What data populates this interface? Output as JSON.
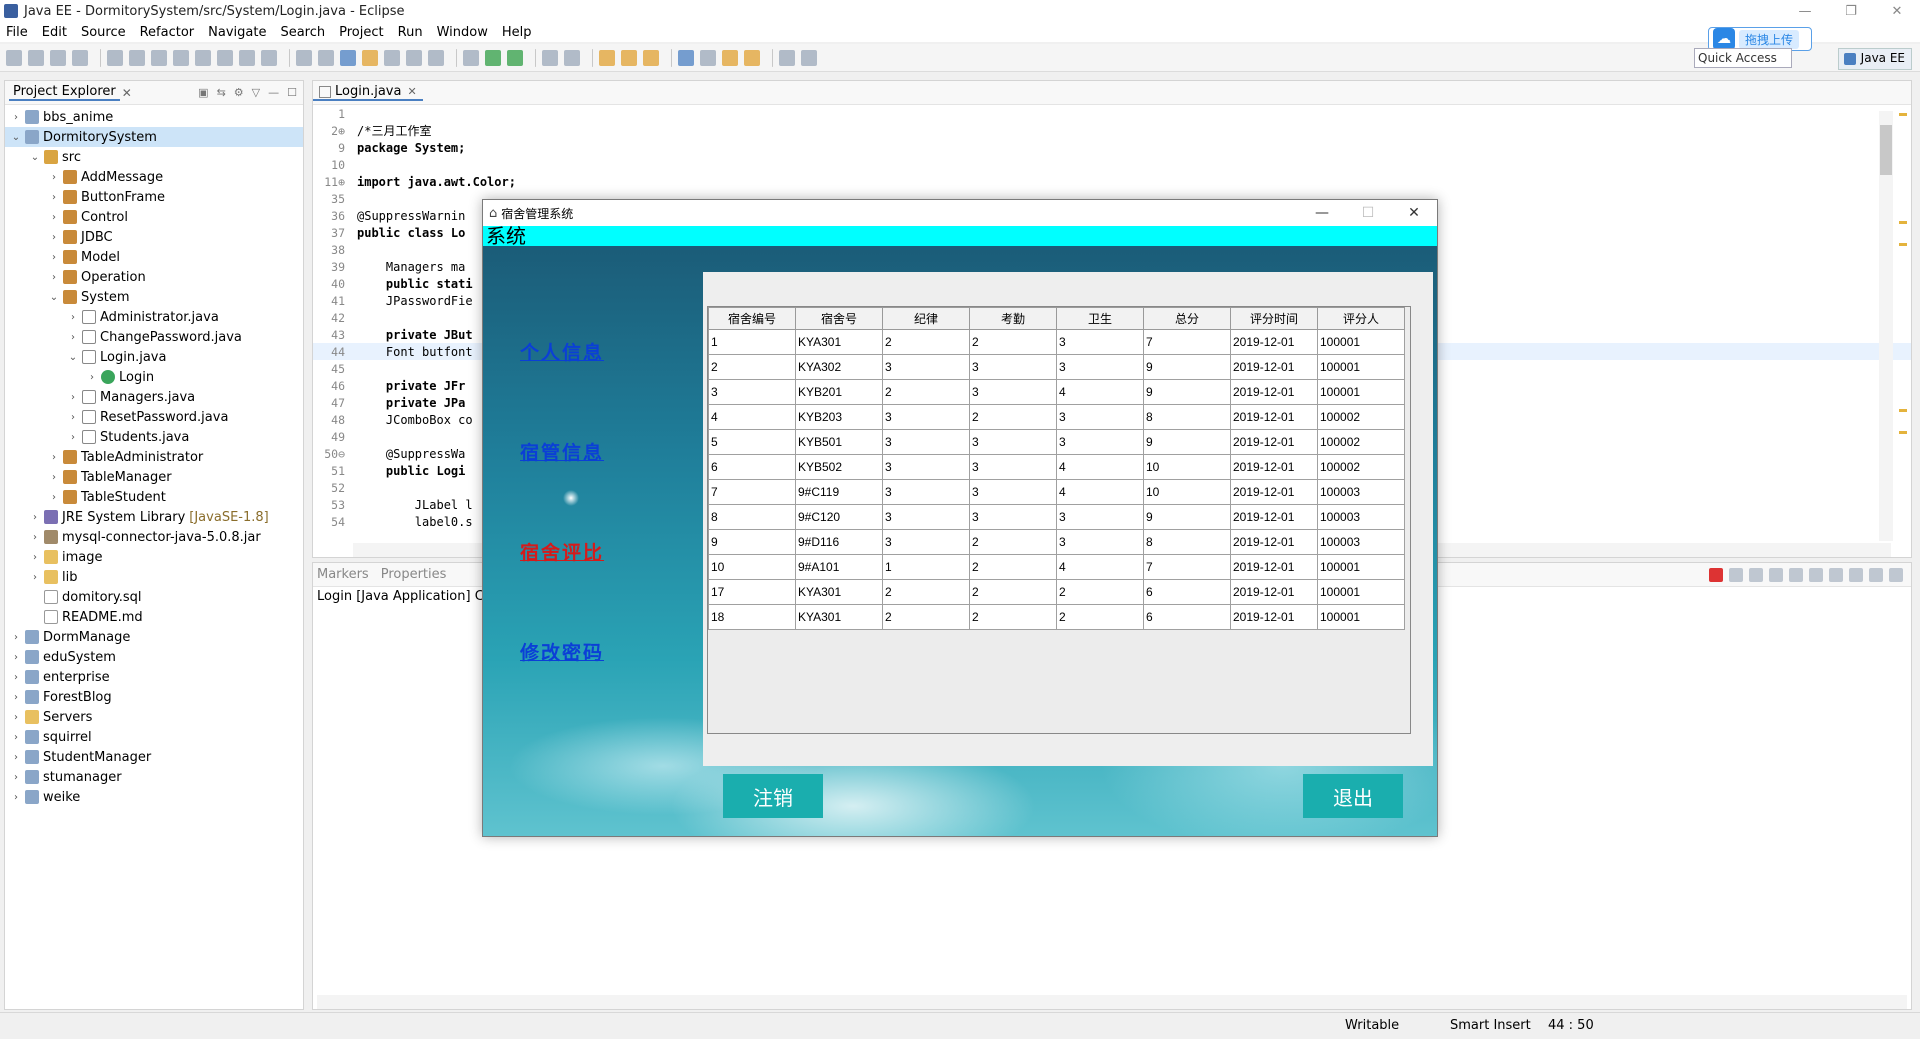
{
  "window": {
    "title": "Java EE - DormitorySystem/src/System/Login.java - Eclipse"
  },
  "menu": [
    "File",
    "Edit",
    "Source",
    "Refactor",
    "Navigate",
    "Search",
    "Project",
    "Run",
    "Window",
    "Help"
  ],
  "toolbar": {
    "quick_access": "Quick Access",
    "perspective": "Java EE",
    "upload_label": "拖拽上传"
  },
  "project_explorer": {
    "title": "Project Explorer",
    "items": [
      {
        "label": "bbs_anime",
        "indent": 0,
        "arrow": "›",
        "icon": "project",
        "decor": ""
      },
      {
        "label": "DormitorySystem",
        "indent": 0,
        "arrow": "⌄",
        "icon": "project",
        "decor": "",
        "selected": true
      },
      {
        "label": "src",
        "indent": 1,
        "arrow": "⌄",
        "icon": "srcfolder",
        "decor": ""
      },
      {
        "label": "AddMessage",
        "indent": 2,
        "arrow": "›",
        "icon": "package",
        "decor": ""
      },
      {
        "label": "ButtonFrame",
        "indent": 2,
        "arrow": "›",
        "icon": "package",
        "decor": ""
      },
      {
        "label": "Control",
        "indent": 2,
        "arrow": "›",
        "icon": "package",
        "decor": ""
      },
      {
        "label": "JDBC",
        "indent": 2,
        "arrow": "›",
        "icon": "package",
        "decor": ""
      },
      {
        "label": "Model",
        "indent": 2,
        "arrow": "›",
        "icon": "package",
        "decor": ""
      },
      {
        "label": "Operation",
        "indent": 2,
        "arrow": "›",
        "icon": "package",
        "decor": ""
      },
      {
        "label": "System",
        "indent": 2,
        "arrow": "⌄",
        "icon": "package",
        "decor": ""
      },
      {
        "label": "Administrator.java",
        "indent": 3,
        "arrow": "›",
        "icon": "javafile",
        "decor": ""
      },
      {
        "label": "ChangePassword.java",
        "indent": 3,
        "arrow": "›",
        "icon": "javafile",
        "decor": ""
      },
      {
        "label": "Login.java",
        "indent": 3,
        "arrow": "⌄",
        "icon": "javafile",
        "decor": ""
      },
      {
        "label": "Login",
        "indent": 4,
        "arrow": "›",
        "icon": "class",
        "decor": ""
      },
      {
        "label": "Managers.java",
        "indent": 3,
        "arrow": "›",
        "icon": "javafile",
        "decor": ""
      },
      {
        "label": "ResetPassword.java",
        "indent": 3,
        "arrow": "›",
        "icon": "javafile",
        "decor": ""
      },
      {
        "label": "Students.java",
        "indent": 3,
        "arrow": "›",
        "icon": "javafile",
        "decor": ""
      },
      {
        "label": "TableAdministrator",
        "indent": 2,
        "arrow": "›",
        "icon": "package",
        "decor": ""
      },
      {
        "label": "TableManager",
        "indent": 2,
        "arrow": "›",
        "icon": "package",
        "decor": ""
      },
      {
        "label": "TableStudent",
        "indent": 2,
        "arrow": "›",
        "icon": "package",
        "decor": ""
      },
      {
        "label": "JRE System Library",
        "indent": 1,
        "arrow": "›",
        "icon": "library",
        "decor": "[JavaSE-1.8]"
      },
      {
        "label": "mysql-connector-java-5.0.8.jar",
        "indent": 1,
        "arrow": "›",
        "icon": "jar",
        "decor": ""
      },
      {
        "label": "image",
        "indent": 1,
        "arrow": "›",
        "icon": "folder",
        "decor": ""
      },
      {
        "label": "lib",
        "indent": 1,
        "arrow": "›",
        "icon": "folder",
        "decor": ""
      },
      {
        "label": "domitory.sql",
        "indent": 1,
        "arrow": "",
        "icon": "file",
        "decor": ""
      },
      {
        "label": "README.md",
        "indent": 1,
        "arrow": "",
        "icon": "file",
        "decor": ""
      },
      {
        "label": "DormManage",
        "indent": 0,
        "arrow": "›",
        "icon": "project",
        "decor": ""
      },
      {
        "label": "eduSystem",
        "indent": 0,
        "arrow": "›",
        "icon": "project",
        "decor": ""
      },
      {
        "label": "enterprise",
        "indent": 0,
        "arrow": "›",
        "icon": "project",
        "decor": ""
      },
      {
        "label": "ForestBlog",
        "indent": 0,
        "arrow": "›",
        "icon": "project",
        "decor": ""
      },
      {
        "label": "Servers",
        "indent": 0,
        "arrow": "›",
        "icon": "folder",
        "decor": ""
      },
      {
        "label": "squirrel",
        "indent": 0,
        "arrow": "›",
        "icon": "project",
        "decor": ""
      },
      {
        "label": "StudentManager",
        "indent": 0,
        "arrow": "›",
        "icon": "project",
        "decor": ""
      },
      {
        "label": "stumanager",
        "indent": 0,
        "arrow": "›",
        "icon": "project",
        "decor": ""
      },
      {
        "label": "weike",
        "indent": 0,
        "arrow": "›",
        "icon": "project",
        "decor": ""
      }
    ]
  },
  "editor": {
    "tab": "Login.java",
    "lines": [
      {
        "num": "1",
        "text": ""
      },
      {
        "num": "2⊕",
        "text": "/*三月工作室"
      },
      {
        "num": "9",
        "text": "package System;"
      },
      {
        "num": "10",
        "text": ""
      },
      {
        "num": "11⊕",
        "text": "import java.awt.Color;"
      },
      {
        "num": "35",
        "text": ""
      },
      {
        "num": "36",
        "text": "@SuppressWarnin"
      },
      {
        "num": "37",
        "text": "public class Lo"
      },
      {
        "num": "38",
        "text": ""
      },
      {
        "num": "39",
        "text": "    Managers ma"
      },
      {
        "num": "40",
        "text": "    public stati"
      },
      {
        "num": "41",
        "text": "    JPasswordFie"
      },
      {
        "num": "42",
        "text": ""
      },
      {
        "num": "43",
        "text": "    private JBut"
      },
      {
        "num": "44",
        "text": "    Font butfont",
        "hl": true
      },
      {
        "num": "45",
        "text": ""
      },
      {
        "num": "46",
        "text": "    private JFr"
      },
      {
        "num": "47",
        "text": "    private JPa"
      },
      {
        "num": "48",
        "text": "    JComboBox co"
      },
      {
        "num": "49",
        "text": ""
      },
      {
        "num": "50⊖",
        "text": "    @SuppressWa"
      },
      {
        "num": "51",
        "text": "    public Logi"
      },
      {
        "num": "52",
        "text": ""
      },
      {
        "num": "53",
        "text": "        JLabel l"
      },
      {
        "num": "54",
        "text": "        label0.s"
      }
    ]
  },
  "console": {
    "tabs": [
      "Markers",
      "Properties"
    ],
    "title": "Login [Java Application] C:\\jav"
  },
  "status": {
    "writable": "Writable",
    "insert_mode": "Smart Insert",
    "position": "44 : 50"
  },
  "app": {
    "title": "宿舍管理系统",
    "banner": "系统",
    "nav": [
      "个人信息",
      "宿管信息",
      "宿舍评比",
      "修改密码"
    ],
    "nav_active": 2,
    "table": {
      "columns": [
        "宿舍编号",
        "宿舍号",
        "纪律",
        "考勤",
        "卫生",
        "总分",
        "评分时间",
        "评分人"
      ],
      "rows": [
        [
          "1",
          "KYA301",
          "2",
          "2",
          "3",
          "7",
          "2019-12-01",
          "100001"
        ],
        [
          "2",
          "KYA302",
          "3",
          "3",
          "3",
          "9",
          "2019-12-01",
          "100001"
        ],
        [
          "3",
          "KYB201",
          "2",
          "3",
          "4",
          "9",
          "2019-12-01",
          "100001"
        ],
        [
          "4",
          "KYB203",
          "3",
          "2",
          "3",
          "8",
          "2019-12-01",
          "100002"
        ],
        [
          "5",
          "KYB501",
          "3",
          "3",
          "3",
          "9",
          "2019-12-01",
          "100002"
        ],
        [
          "6",
          "KYB502",
          "3",
          "3",
          "4",
          "10",
          "2019-12-01",
          "100002"
        ],
        [
          "7",
          "9#C119",
          "3",
          "3",
          "4",
          "10",
          "2019-12-01",
          "100003"
        ],
        [
          "8",
          "9#C120",
          "3",
          "3",
          "3",
          "9",
          "2019-12-01",
          "100003"
        ],
        [
          "9",
          "9#D116",
          "3",
          "2",
          "3",
          "8",
          "2019-12-01",
          "100003"
        ],
        [
          "10",
          "9#A101",
          "1",
          "2",
          "4",
          "7",
          "2019-12-01",
          "100001"
        ],
        [
          "17",
          "KYA301",
          "2",
          "2",
          "2",
          "6",
          "2019-12-01",
          "100001"
        ],
        [
          "18",
          "KYA301",
          "2",
          "2",
          "2",
          "6",
          "2019-12-01",
          "100001"
        ]
      ]
    },
    "logout_label": "注销",
    "exit_label": "退出"
  }
}
